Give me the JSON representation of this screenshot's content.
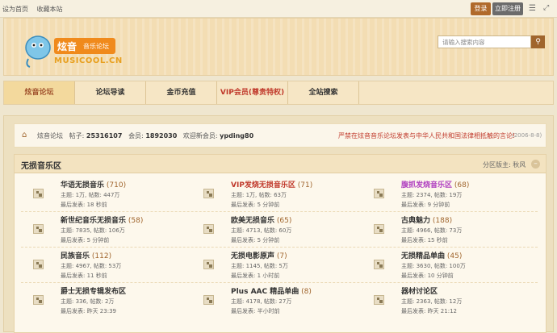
{
  "topbar": {
    "links": [
      "设为首页",
      "收藏本站"
    ],
    "login": "登录",
    "register": "立即注册"
  },
  "header": {
    "logo_text": "炫音",
    "logo_sub": "音乐论坛",
    "logo_domain": "MUSICOOL.CN",
    "search_placeholder": "请输入搜索内容"
  },
  "nav": {
    "items": [
      "炫音论坛",
      "论坛导读",
      "金币充值",
      "VIP会员(尊贵特权)",
      "全站搜索"
    ]
  },
  "breadcrumb": {
    "home": "炫音论坛",
    "posts_label": "帖子:",
    "posts": "25316107",
    "members_label": "会员:",
    "members": "1892030",
    "welcome_label": "欢迎新会员:",
    "new_member": "ypding80",
    "announcement": "严禁在炫音音乐论坛发表与中华人民共和国法律相抵触的言论!",
    "announce_date": "(2006-8-8)"
  },
  "section": {
    "title": "无损音乐区",
    "moderator": "分区版主: 秋风"
  },
  "forums": [
    {
      "name": "华语无损音乐",
      "count": "(710)",
      "stats": "主题: 1万, 帖数: 447万",
      "last": "最后发表: 18 秒前",
      "style": ""
    },
    {
      "name": "VIP发烧无损音乐区",
      "count": "(71)",
      "stats": "主题: 1万, 帖数: 63万",
      "last": "最后发表: 5 分钟前",
      "style": "red"
    },
    {
      "name": "腹抓发烧音乐区",
      "count": "(68)",
      "stats": "主题: 2374, 帖数: 19万",
      "last": "最后发表: 9 分钟前",
      "style": "purple"
    },
    {
      "name": "新世纪音乐无损音乐",
      "count": "(58)",
      "stats": "主题: 7835, 帖数: 106万",
      "last": "最后发表: 5 分钟前",
      "style": ""
    },
    {
      "name": "欧美无损音乐",
      "count": "(65)",
      "stats": "主题: 4713, 帖数: 60万",
      "last": "最后发表: 5 分钟前",
      "style": ""
    },
    {
      "name": "古典魅力",
      "count": "(188)",
      "stats": "主题: 4966, 帖数: 73万",
      "last": "最后发表: 15 秒前",
      "style": ""
    },
    {
      "name": "民族音乐",
      "count": "(112)",
      "stats": "主题: 4967, 帖数: 53万",
      "last": "最后发表: 11 秒前",
      "style": ""
    },
    {
      "name": "无损电影原声",
      "count": "(7)",
      "stats": "主题: 1145, 帖数: 5万",
      "last": "最后发表: 1 小时前",
      "style": ""
    },
    {
      "name": "无损精品单曲",
      "count": "(45)",
      "stats": "主题: 3630, 帖数: 100万",
      "last": "最后发表: 10 分钟前",
      "style": ""
    },
    {
      "name": "爵士无损专辑发布区",
      "count": "",
      "stats": "主题: 336, 帖数: 2万",
      "last": "最后发表: 昨天 23:39",
      "style": ""
    },
    {
      "name": "Plus AAC 精品单曲",
      "count": "(8)",
      "stats": "主题: 4178, 帖数: 27万",
      "last": "最后发表: 半小时前",
      "style": ""
    },
    {
      "name": "器材讨论区",
      "count": "",
      "stats": "主题: 2363, 帖数: 12万",
      "last": "最后发表: 昨天 21:12",
      "style": ""
    }
  ],
  "colors": {
    "accent": "#a0652d",
    "red": "#c0392b",
    "purple": "#b040c0",
    "background": "#efe6cf"
  }
}
